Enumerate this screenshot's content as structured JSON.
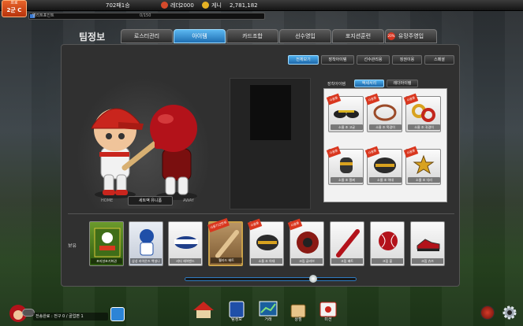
{
  "top": {
    "rank_line1": "프로",
    "rank_line2": "2군 C",
    "record": "702패1승",
    "ladder_label": "레더",
    "ladder_value": "2000",
    "money_label": "게니",
    "money_value": "2,781,182",
    "xp_label": "엘리트포인트",
    "xp_value": "0/150",
    "xp_progress": 0.02
  },
  "nav": {
    "title": "팀정보",
    "tabs": [
      {
        "label": "로스터관리"
      },
      {
        "label": "아이템"
      },
      {
        "label": "카드조합"
      },
      {
        "label": "선수영입"
      },
      {
        "label": "포지션훈련"
      },
      {
        "label": "유망주영입",
        "badge": "20%"
      }
    ]
  },
  "subtabs": [
    "전체보기",
    "장착아이템",
    "선수관리용",
    "징권이용",
    "스페셜"
  ],
  "character": {
    "home_label": "HOME",
    "away_label": "AWAY",
    "set_button": "세트액 유니폼"
  },
  "equip": {
    "title": "장착아이템",
    "tabs": [
      "액세서리",
      "레더아이템"
    ],
    "slots": [
      {
        "tag": "사용중",
        "name": "소울 조 고글"
      },
      {
        "tag": "사용중",
        "name": "소울 조 목걸이"
      },
      {
        "tag": "사용중",
        "name": "소울 조 귀걸이"
      },
      {
        "tag": "사용중",
        "name": "소울 조 팔찌"
      },
      {
        "tag": "사용중",
        "name": "소울 조 아대"
      },
      {
        "tag": "사용중",
        "name": "소울 조 다리"
      }
    ]
  },
  "inventory": {
    "label": "보유",
    "items": [
      {
        "name": "포지션초기화권",
        "tag": ""
      },
      {
        "name": "삼성 라이온즈 백설나",
        "tag": ""
      },
      {
        "name": "리더 헤어밴드",
        "tag": ""
      },
      {
        "name": "웰라드 배트",
        "tag": "사용기간만료"
      },
      {
        "name": "소울 조 아대",
        "tag": "사용중"
      },
      {
        "name": "크립 글러브",
        "tag": "사용중"
      },
      {
        "name": "크립 배트",
        "tag": ""
      },
      {
        "name": "크립 볼",
        "tag": ""
      },
      {
        "name": "크립 슈즈",
        "tag": ""
      }
    ]
  },
  "bottom": {
    "status": "전송완료 : 전구 0 / 골업편 1",
    "nav": [
      {
        "label": ""
      },
      {
        "label": "팀정보"
      },
      {
        "label": "거래"
      },
      {
        "label": "상점"
      },
      {
        "label": "미션"
      }
    ]
  },
  "colors": {
    "accent": "#1f6fb3",
    "tag_red": "#d9371f",
    "rank_orange": "#e8642a"
  }
}
